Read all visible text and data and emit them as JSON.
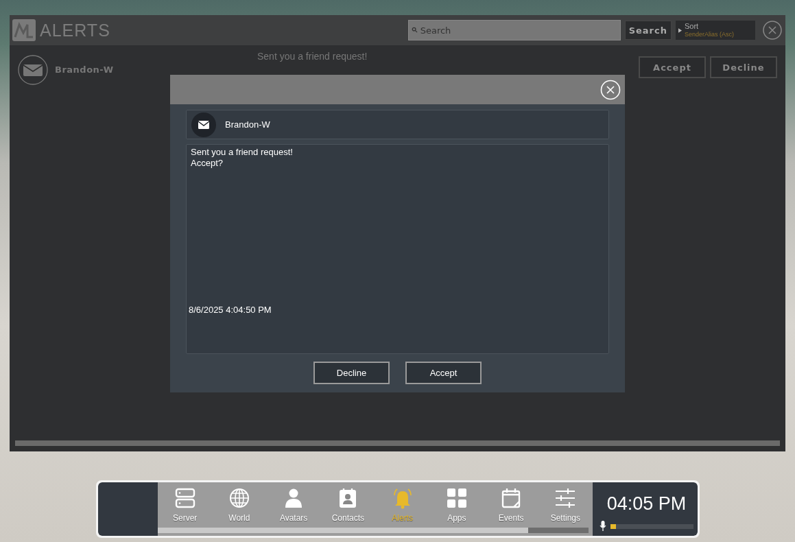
{
  "alerts_window": {
    "title": "ALERTS",
    "search": {
      "placeholder": "Search"
    },
    "search_button": "Search",
    "sort": {
      "label": "Sort",
      "value": "SenderAlias (Asc)"
    },
    "alerts": [
      {
        "sender": "Brandon-W",
        "message": "Sent you a friend request!",
        "accept": "Accept",
        "decline": "Decline"
      }
    ]
  },
  "dialog": {
    "sender": "Brandon-W",
    "message": "Sent you a friend request!\nAccept?",
    "timestamp": "8/6/2025 4:04:50 PM",
    "buttons": [
      {
        "label": "Decline"
      },
      {
        "label": "Accept"
      }
    ]
  },
  "taskbar": {
    "items": [
      {
        "label": "Server",
        "kind": "server",
        "selected": false
      },
      {
        "label": "World",
        "kind": "world",
        "selected": false
      },
      {
        "label": "Avatars",
        "kind": "avatar",
        "selected": false
      },
      {
        "label": "Contacts",
        "kind": "contacts",
        "selected": false
      },
      {
        "label": "Alerts",
        "kind": "bell",
        "selected": true
      },
      {
        "label": "Apps",
        "kind": "apps",
        "selected": false
      },
      {
        "label": "Events",
        "kind": "calendar",
        "selected": false
      },
      {
        "label": "Settings",
        "kind": "sliders",
        "selected": false
      }
    ],
    "clock": "04:05 PM",
    "mic": {
      "level": 0.07
    }
  }
}
